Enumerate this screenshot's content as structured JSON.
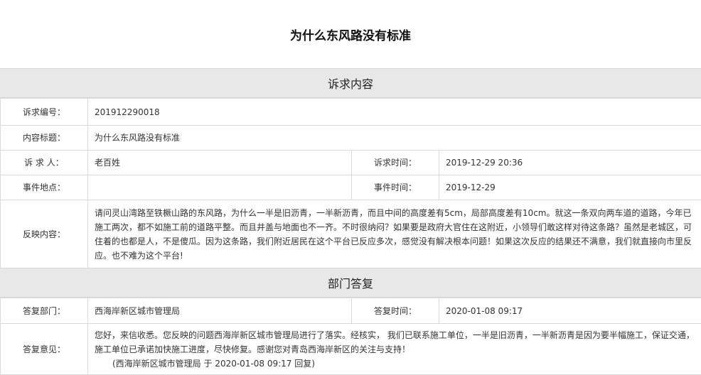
{
  "title": "为什么东风路没有标准",
  "section_request": "诉求内容",
  "section_reply": "部门答复",
  "request": {
    "id_label": "诉求编号：",
    "id_value": "201912290018",
    "subject_label": "内容标题：",
    "subject_value": "为什么东风路没有标准",
    "person_label": "诉 求 人：",
    "person_value": "老百姓",
    "time_label": "诉求时间：",
    "time_value": "2019-12-29 20:36",
    "location_label": "事件地点：",
    "location_value": "",
    "event_time_label": "事件时间：",
    "event_time_value": "2019-12-29",
    "content_label": "反映内容：",
    "content_value": "请问灵山湾路至铁橛山路的东风路，为什么一半是旧沥青，一半新沥青，而且中间的高度差有5cm，局部高度差有10cm。就这一条双向两车道的道路，今年已施工两次，都不如施工前的道路平整。而且井盖与地面也不一齐。不时很纳闷？如果要是政府大官住在这附近，小领导们敢这样对待这条路？虽然是老城区，可住着的也都是人，不是傻瓜。因为这条路，我们附近居民在这个平台已反应多次，感觉没有解决根本问题！如果这次反应的结果还不满意，我们就直接向市里反应。也不难为这个平台!"
  },
  "reply": {
    "dept_label": "答复部门：",
    "dept_value": "西海岸新区城市管理局",
    "time_label": "答复时间：",
    "time_value": "2020-01-08 09:17",
    "opinion_label": "答复意见：",
    "opinion_value": "您好，来信收悉。您反映的问题西海岸新区城市管理局进行了落实。经核实， 我们已联系施工单位，一半是旧沥青，一半新沥青是因为要半幅施工，保证交通，施工单位已承诺加快施工进度，尽快修复。感谢您对青岛西海岸新区的关注与支持！",
    "signature": "(西海岸新区城市管理局 于 2020-01-08 09:17 回复)"
  }
}
